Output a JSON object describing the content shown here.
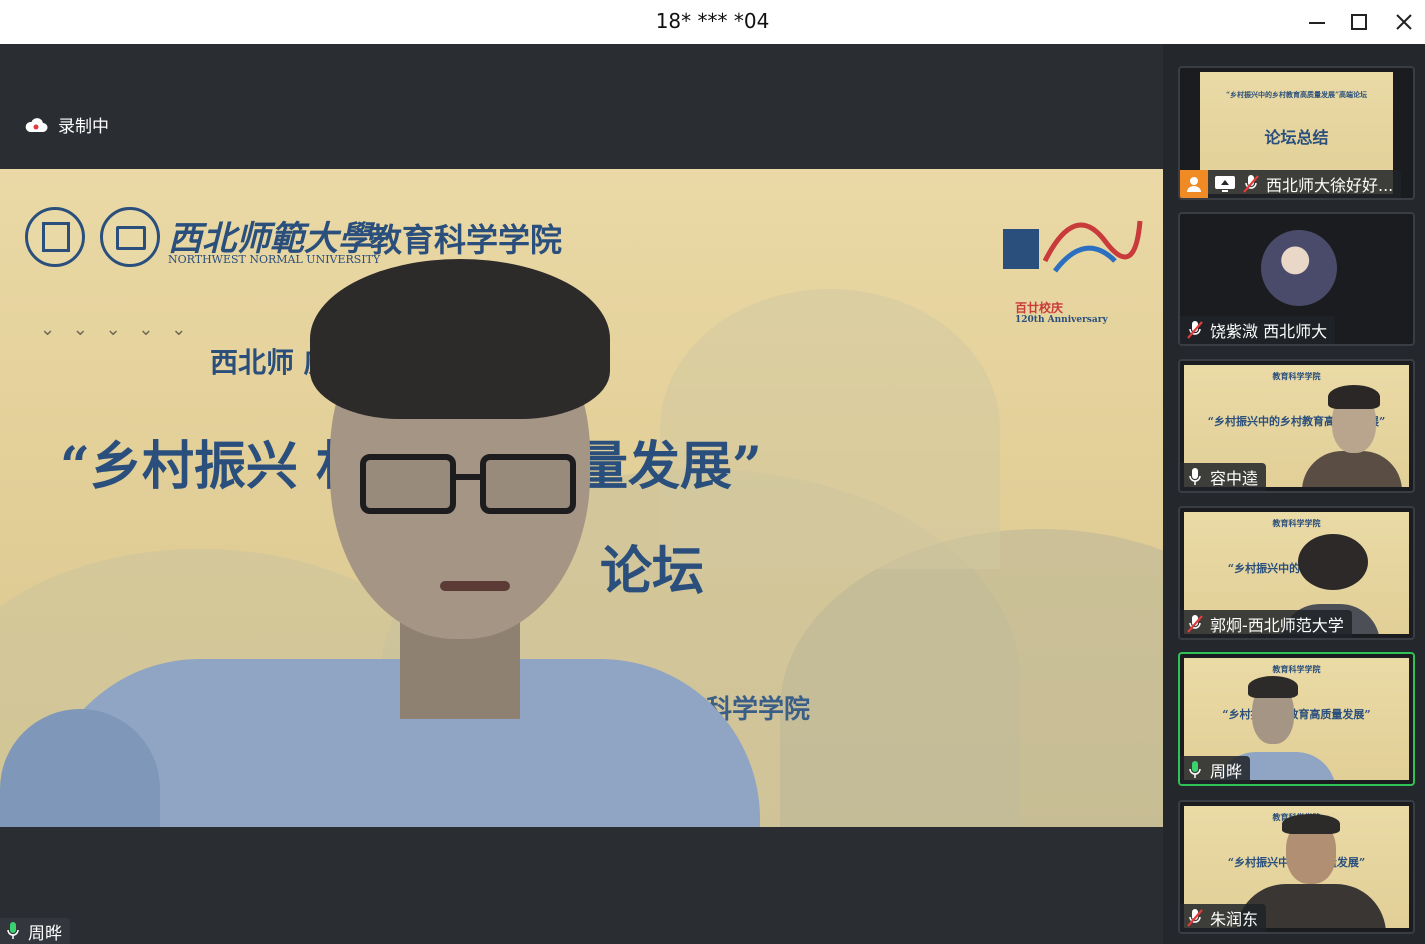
{
  "window": {
    "title": "18* *** *04"
  },
  "recording": {
    "label": "录制中"
  },
  "main_video": {
    "speaker_name": "周晔",
    "slide": {
      "university_cn": "西北师範大學",
      "university_en": "NORTHWEST NORMAL UNIVERSITY",
      "college": "教育科学学院",
      "anniversary_cn": "百廿校庆",
      "anniversary_en": "120th Anniversary",
      "subtitle": "西北师 庆·系列学术活动之一",
      "headline": "“乡村振兴 村教育高质量发展”",
      "line3": "论坛",
      "footer": "育科学学院"
    }
  },
  "participants": [
    {
      "name": "西北师大徐好好...",
      "mic": "muted",
      "screen_share": true,
      "thumb_title": "论坛总结",
      "thumb_header": "“乡村振兴中的乡村教育高质量发展”高端论坛"
    },
    {
      "name": "饶紫溦 西北师大",
      "mic": "muted"
    },
    {
      "name": "容中逵",
      "mic": "on",
      "thumb_header": "教育科学学院",
      "thumb_title": "“乡村振兴中的乡村教育高质量发展”"
    },
    {
      "name": "郭炯-西北师范大学",
      "mic": "muted",
      "thumb_header": "教育科学学院",
      "thumb_title": "“乡村振兴中的 高质量发展”"
    },
    {
      "name": "周晔",
      "mic": "on",
      "active": true,
      "thumb_header": "教育科学学院",
      "thumb_title": "“乡村振兴 村教育高质量发展”"
    },
    {
      "name": "朱润东",
      "mic": "muted",
      "thumb_header": "教育科学学院",
      "thumb_title": "“乡村振兴中的 高质量发展”"
    }
  ],
  "colors": {
    "active_border": "#2fc255",
    "mic_on": "#3bd16f",
    "mic_off": "#e23b3b",
    "slide_text": "#2a4f7c"
  }
}
